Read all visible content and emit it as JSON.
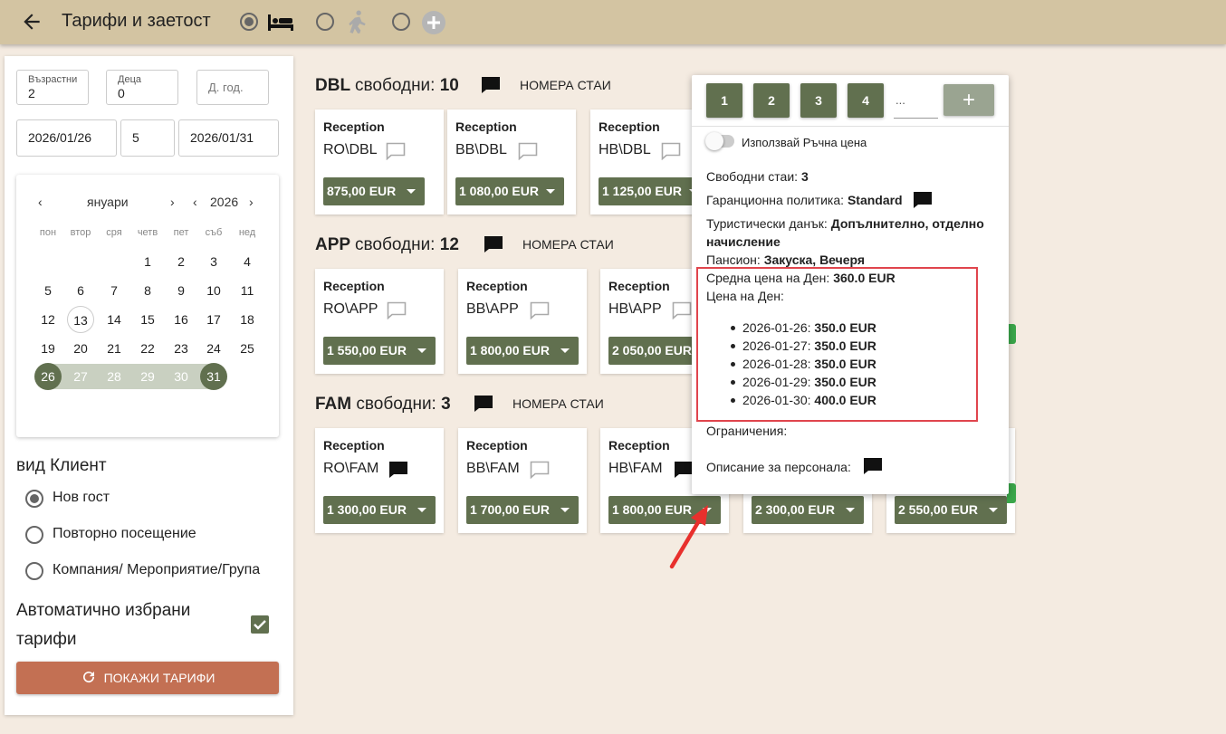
{
  "header": {
    "title": "Тарифи и заетост"
  },
  "search": {
    "adults_label": "Възрастни",
    "adults_value": "2",
    "children_label": "Деца",
    "children_value": "0",
    "age_placeholder": "Д. год.",
    "date_from": "2026/01/26",
    "nights": "5",
    "date_to": "2026/01/31"
  },
  "calendar": {
    "month": "януари",
    "year": "2026",
    "weekdays": [
      "пон",
      "втор",
      "сря",
      "четв",
      "пет",
      "съб",
      "нед"
    ],
    "weeks": [
      [
        "",
        "",
        "",
        "1",
        "2",
        "3",
        "4"
      ],
      [
        "5",
        "6",
        "7",
        "8",
        "9",
        "10",
        "11"
      ],
      [
        "12",
        "13",
        "14",
        "15",
        "16",
        "17",
        "18"
      ],
      [
        "19",
        "20",
        "21",
        "22",
        "23",
        "24",
        "25"
      ],
      [
        "26",
        "27",
        "28",
        "29",
        "30",
        "31",
        ""
      ]
    ]
  },
  "client_type": {
    "title": "вид Клиент",
    "options": [
      "Нов гост",
      "Повторно посещение",
      "Компания/ Мероприятие/Група"
    ],
    "selected": "Нов гост"
  },
  "auto_rates": {
    "line1": "Автоматично избрани",
    "line2": "тарифи",
    "checked": true
  },
  "show_button": "ПОКАЖИ ТАРИФИ",
  "room_types": [
    {
      "code": "DBL",
      "free_label": "свободни:",
      "free": "10",
      "rooms_link": "НОМЕРА СТАИ",
      "cards": [
        {
          "source": "Reception",
          "rate": "RO\\DBL",
          "price": "875,00 EUR"
        },
        {
          "source": "Reception",
          "rate": "BB\\DBL",
          "price": "1 080,00 EUR"
        },
        {
          "source": "Reception",
          "rate": "HB\\DBL",
          "price": "1 125,00 EUR"
        }
      ]
    },
    {
      "code": "APP",
      "free_label": "свободни:",
      "free": "12",
      "rooms_link": "НОМЕРА СТАИ",
      "cards": [
        {
          "source": "Reception",
          "rate": "RO\\APP",
          "price": "1 550,00 EUR"
        },
        {
          "source": "Reception",
          "rate": "BB\\APP",
          "price": "1 800,00 EUR"
        },
        {
          "source": "Reception",
          "rate": "HB\\APP",
          "price": "2 050,00 EUR"
        }
      ]
    },
    {
      "code": "FAM",
      "free_label": "свободни:",
      "free": "3",
      "rooms_link": "НОМЕРА СТАИ",
      "cards": [
        {
          "source": "Reception",
          "rate": "RO\\FAM",
          "price": "1 300,00 EUR"
        },
        {
          "source": "Reception",
          "rate": "BB\\FAM",
          "price": "1 700,00 EUR"
        },
        {
          "source": "Reception",
          "rate": "HB\\FAM",
          "price": "1 800,00 EUR"
        },
        {
          "source": "",
          "rate": "",
          "price": "2 300,00 EUR"
        },
        {
          "source": "",
          "rate": "",
          "price": "2 550,00 EUR"
        }
      ]
    }
  ],
  "popover": {
    "room_buttons": [
      "1",
      "2",
      "3",
      "4"
    ],
    "custom_placeholder": "...",
    "manual_price_label": "Използвай Ръчна цена",
    "free_rooms_label": "Свободни стаи:",
    "free_rooms": "3",
    "guarantee_label": "Гаранционна политика:",
    "guarantee": "Standard",
    "tax_label": "Туристически данък:",
    "tax_line1": "Допълнително, отделно",
    "tax_line2": "начисление",
    "board_label": "Пансион:",
    "board": "Закуска, Вечеря",
    "avg_label": "Средна цена на Ден:",
    "avg": "360.0 EUR",
    "daily_label": "Цена на Ден:",
    "daily": [
      {
        "date": "2026-01-26:",
        "price": "350.0 EUR"
      },
      {
        "date": "2026-01-27:",
        "price": "350.0 EUR"
      },
      {
        "date": "2026-01-28:",
        "price": "350.0 EUR"
      },
      {
        "date": "2026-01-29:",
        "price": "350.0 EUR"
      },
      {
        "date": "2026-01-30:",
        "price": "400.0 EUR"
      }
    ],
    "restrictions_label": "Ограничения:",
    "staff_desc_label": "Описание за персонала:"
  },
  "colors": {
    "accent": "#61704f",
    "header": "#d3c4a2",
    "background": "#f4ebe1",
    "button": "#c37053",
    "highlight": "#e0454d",
    "arrow": "#e8302d"
  }
}
